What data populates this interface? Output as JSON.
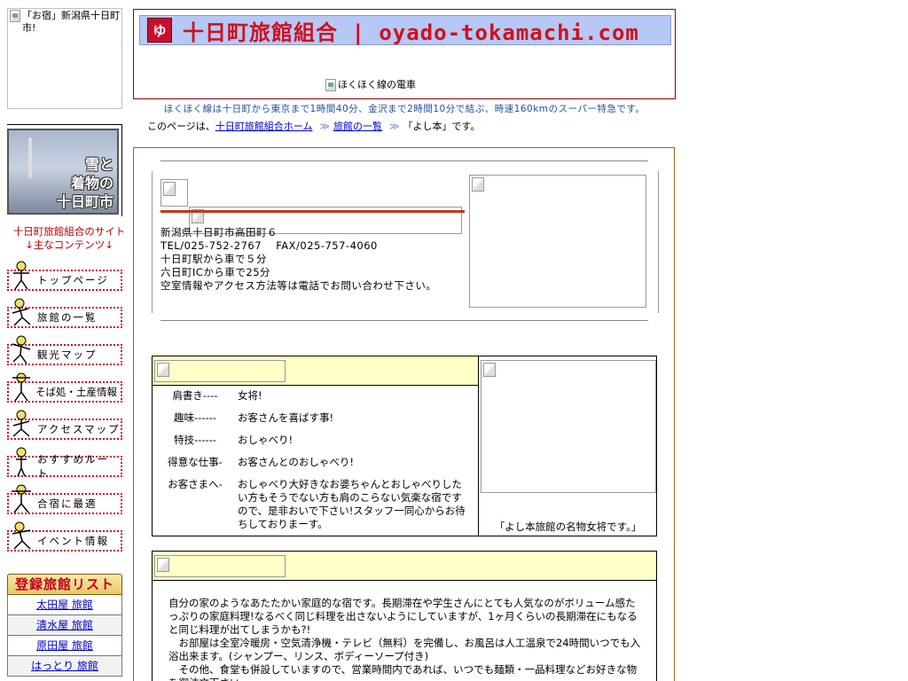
{
  "left": {
    "logo_alt": "「お宿」新潟県十日町市!",
    "banner_text": [
      "雪と",
      "着物の",
      "十日町市"
    ],
    "site_note": [
      "十日町旅館組合のサイト",
      "↓主なコンテンツ↓"
    ],
    "nav": [
      {
        "label": "トップページ"
      },
      {
        "label": "旅館の一覧"
      },
      {
        "label": "観光マップ"
      },
      {
        "label": "そば処・土産情報"
      },
      {
        "label": "アクセスマップ"
      },
      {
        "label": "おすすめルート"
      },
      {
        "label": "合宿に最適"
      },
      {
        "label": "イベント情報"
      }
    ],
    "list_title": "登録旅館リスト",
    "list_items": [
      "太田屋 旅館",
      "清水屋 旅館",
      "原田屋 旅館",
      "はっとり 旅館"
    ]
  },
  "header": {
    "mark": "ゆ",
    "title": "十日町旅館組合 | oyado-tokamachi.com",
    "train_alt": "ほくほく線の電車",
    "tagline": "ほくほく線は十日町から東京まで1時間40分、金沢まで2時間10分で結ぶ、時速160kmのスーパー特急です。"
  },
  "crumb": {
    "prefix": "このページは、",
    "home": "十日町旅館組合ホーム",
    "arrow1": "≫",
    "list": "旅館の一覧",
    "arrow2": "≫",
    "current": "「よし本」です。"
  },
  "info": {
    "address_lines": [
      "新潟県十日町市高田町６",
      "TEL/025-752-2767　 FAX/025-757-4060",
      "十日町駅から車で５分",
      "六日町ICから車で25分",
      "空室情報やアクセス方法等は電話でお問い合わせ下さい。"
    ]
  },
  "profile": {
    "rows": [
      {
        "key": "肩書き----",
        "val": "女将!"
      },
      {
        "key": "趣味------",
        "val": "お客さんを喜ばす事!"
      },
      {
        "key": "特技------",
        "val": "おしゃべり!"
      },
      {
        "key": "得意な仕事-",
        "val": "お客さんとのおしゃべり!"
      },
      {
        "key": "お客さまへ-",
        "val": "おしゃべり大好きなお婆ちゃんとおしゃべりしたい方もそうでない方も肩のこらない気楽な宿ですので、是非おいで下さい!スタッフ一同心からお待ちしておりまーす。"
      }
    ],
    "caption": "「よし本旅館の名物女将です。」"
  },
  "description": {
    "paragraphs": [
      "自分の家のようなあたたかい家庭的な宿です。長期滞在や学生さんにとても人気なのがボリューム感たっぷりの家庭料理!なるべく同じ料理を出さないようにしていますが、1ヶ月くらいの長期滞在にもなると同じ料理が出てしまうかも?!",
      "　お部屋は全室冷暖房・空気清浄機・テレビ（無料）を完備し、お風呂は人工温泉で24時間いつでも入浴出来ます。(シャンプー、リンス、ボディーソープ付き)",
      "　その他、食堂も併設していますので、営業時間内であれば、いつでも麺類・一品料理などお好きな物を御注文下さい。"
    ]
  },
  "colors": {
    "nav_border": "#c8102e",
    "title_bar": "#b6c8f5",
    "title_text": "#d0101e",
    "accent_line": "#c0391b",
    "table_head": "#ffffc8",
    "link": "#0000cc"
  }
}
